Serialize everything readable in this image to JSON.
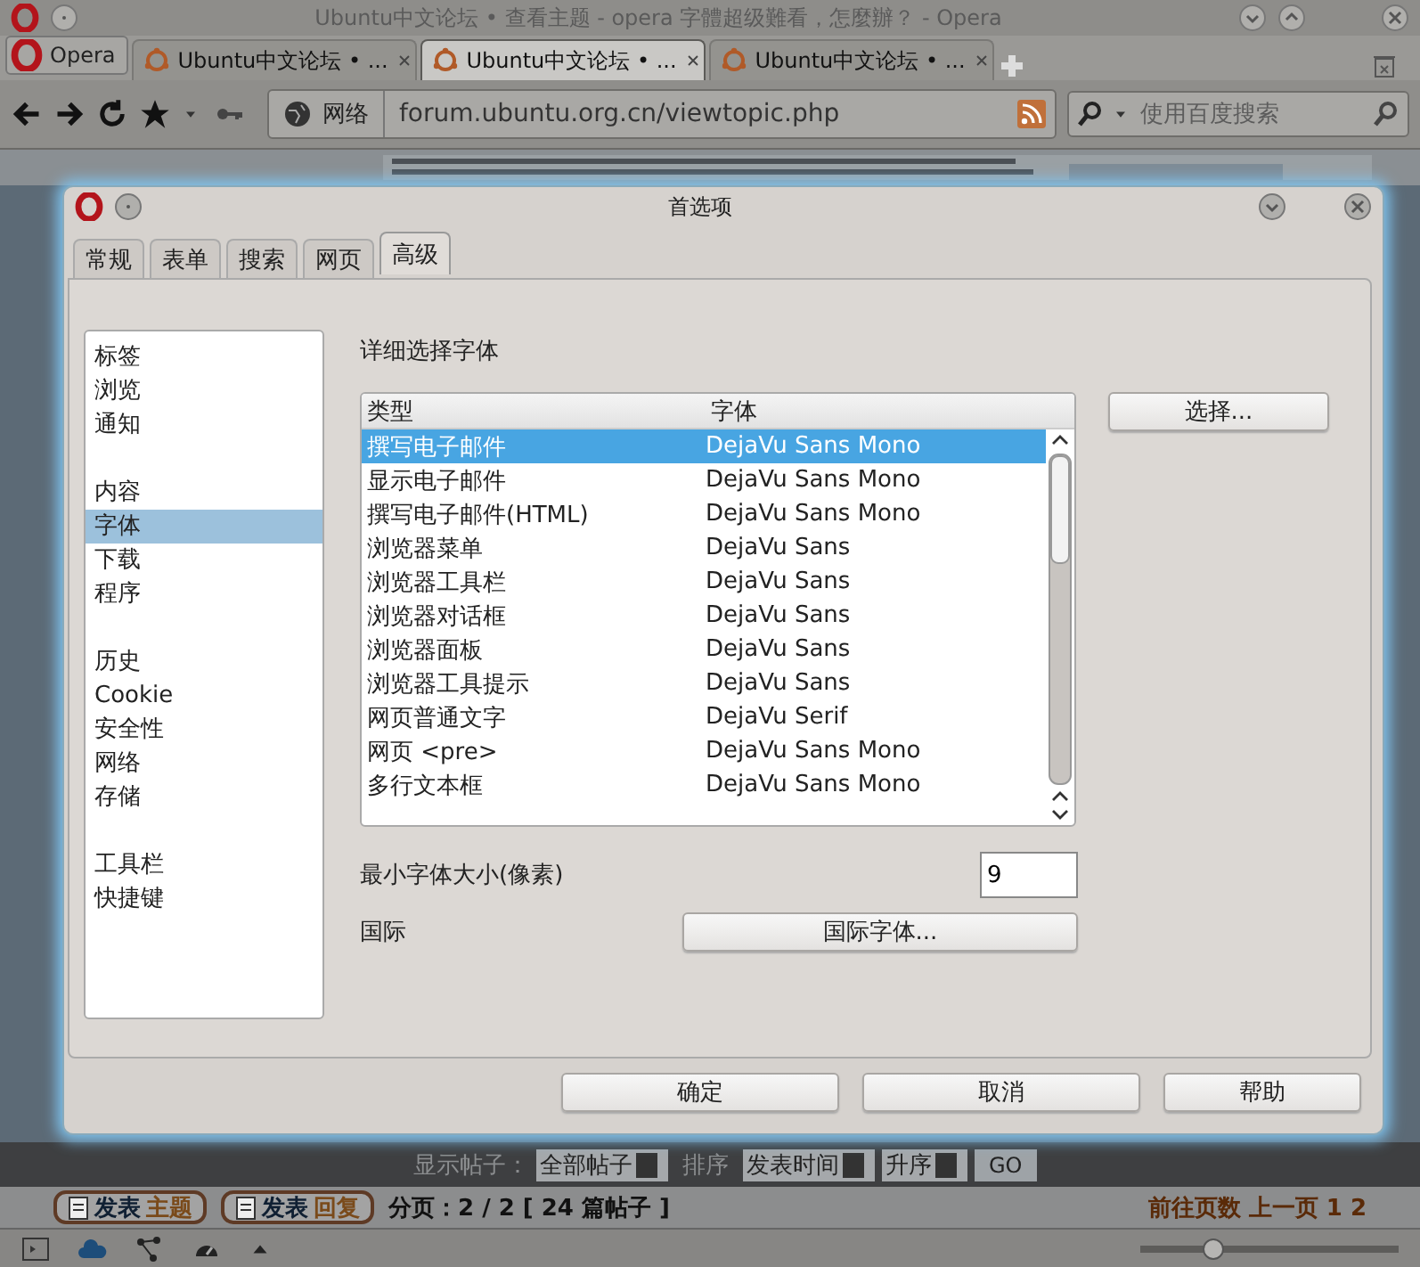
{
  "browser": {
    "title": "Ubuntu中文论坛 • 查看主题 - opera 字體超级難看，怎麼辦？ - Opera",
    "menu_button": "Opera",
    "tabs": [
      {
        "label": "Ubuntu中文论坛 • ...",
        "selected": false
      },
      {
        "label": "Ubuntu中文论坛 • ...",
        "selected": true
      },
      {
        "label": "Ubuntu中文论坛 • ...",
        "selected": false
      }
    ],
    "address": {
      "security_label": "网络",
      "url": "forum.ubuntu.org.cn/viewtopic.php"
    },
    "search": {
      "placeholder": "使用百度搜索"
    }
  },
  "dialog": {
    "title": "首选项",
    "tabs": [
      {
        "label": "常规",
        "selected": false
      },
      {
        "label": "表单",
        "selected": false
      },
      {
        "label": "搜索",
        "selected": false
      },
      {
        "label": "网页",
        "selected": false
      },
      {
        "label": "高级",
        "selected": true
      }
    ],
    "sidebar": {
      "groups": [
        [
          {
            "label": "标签",
            "selected": false
          },
          {
            "label": "浏览",
            "selected": false
          },
          {
            "label": "通知",
            "selected": false
          }
        ],
        [
          {
            "label": "内容",
            "selected": false
          },
          {
            "label": "字体",
            "selected": true
          },
          {
            "label": "下载",
            "selected": false
          },
          {
            "label": "程序",
            "selected": false
          }
        ],
        [
          {
            "label": "历史",
            "selected": false
          },
          {
            "label": "Cookie",
            "selected": false
          },
          {
            "label": "安全性",
            "selected": false
          },
          {
            "label": "网络",
            "selected": false
          },
          {
            "label": "存储",
            "selected": false
          }
        ],
        [
          {
            "label": "工具栏",
            "selected": false
          },
          {
            "label": "快捷键",
            "selected": false
          }
        ]
      ]
    },
    "font_heading": "详细选择字体",
    "table": {
      "columns": [
        "类型",
        "字体"
      ],
      "rows": [
        {
          "type": "撰写电子邮件",
          "font": "DejaVu Sans Mono",
          "selected": true
        },
        {
          "type": "显示电子邮件",
          "font": "DejaVu Sans Mono",
          "selected": false
        },
        {
          "type": "撰写电子邮件(HTML)",
          "font": "DejaVu Sans Mono",
          "selected": false
        },
        {
          "type": "浏览器菜单",
          "font": "DejaVu Sans",
          "selected": false
        },
        {
          "type": "浏览器工具栏",
          "font": "DejaVu Sans",
          "selected": false
        },
        {
          "type": "浏览器对话框",
          "font": "DejaVu Sans",
          "selected": false
        },
        {
          "type": "浏览器面板",
          "font": "DejaVu Sans",
          "selected": false
        },
        {
          "type": "浏览器工具提示",
          "font": "DejaVu Sans",
          "selected": false
        },
        {
          "type": "网页普通文字",
          "font": "DejaVu Serif",
          "selected": false
        },
        {
          "type": "网页 <pre>",
          "font": "DejaVu Sans Mono",
          "selected": false
        },
        {
          "type": "多行文本框",
          "font": "DejaVu Sans Mono",
          "selected": false
        }
      ]
    },
    "choose_button": "选择...",
    "min_size": {
      "label": "最小字体大小(像素)",
      "value": "9"
    },
    "international": {
      "label": "国际",
      "button": "国际字体..."
    },
    "buttons": [
      "确定",
      "取消",
      "帮助"
    ]
  },
  "forum_bar": {
    "show_label": "显示帖子：",
    "show_value": "全部帖子",
    "sort_label": "排序",
    "sort_value": "发表时间",
    "order_value": "升序",
    "go": "GO"
  },
  "post_buttons": [
    {
      "label": "发表",
      "accent": "主题"
    },
    {
      "label": "发表",
      "accent": "回复"
    }
  ],
  "pagination": "分页：2 / 2 [ 24 篇帖子 ]",
  "jump": "前往页数 上一页 1 2",
  "status_bar": {
    "zoom": {
      "level": 0.28
    }
  }
}
